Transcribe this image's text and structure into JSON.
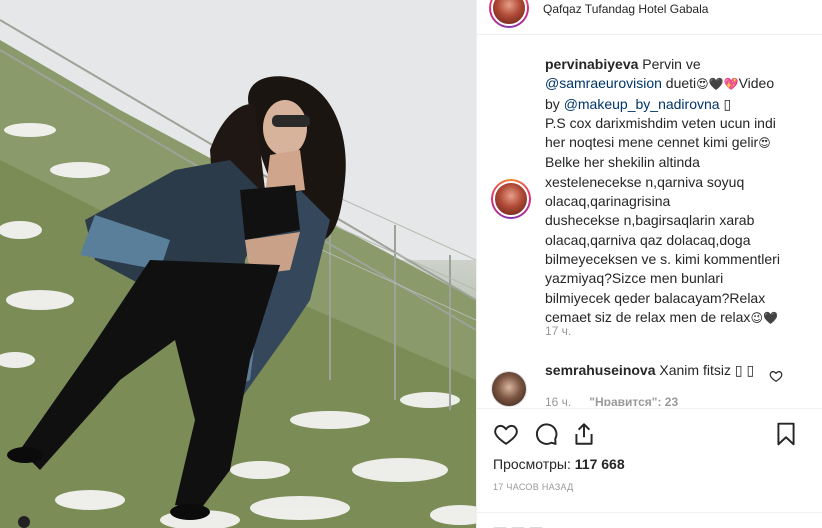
{
  "post": {
    "location": "Qafqaz Tufandag Hotel Gabala",
    "author": "pervinabiyeva",
    "caption_lines": [
      [
        {
          "t": "Pervin ve",
          "c": ""
        }
      ],
      [
        {
          "t": "@samraeurovision",
          "c": "mention"
        },
        {
          "t": " dueti",
          "c": ""
        },
        {
          "t": "😍🖤💖",
          "c": "emoji"
        },
        {
          "t": "Video",
          "c": ""
        }
      ],
      [
        {
          "t": "by ",
          "c": ""
        },
        {
          "t": "@makeup_by_nadirovna",
          "c": "mention"
        },
        {
          "t": " ▯",
          "c": ""
        }
      ],
      [
        {
          "t": "P.S cox darixmishdim veten ucun indi",
          "c": ""
        }
      ],
      [
        {
          "t": "her noqtesi mene cennet kimi gelir",
          "c": ""
        },
        {
          "t": "😍",
          "c": "emoji"
        }
      ],
      [
        {
          "t": "Belke her shekilin altinda",
          "c": ""
        }
      ],
      [
        {
          "t": "xestelenecekse n,qarniva soyuq",
          "c": ""
        }
      ],
      [
        {
          "t": "olacaq,qarinagrisina",
          "c": ""
        }
      ],
      [
        {
          "t": "dushecekse n,bagirsaqlarin xarab",
          "c": ""
        }
      ],
      [
        {
          "t": "olacaq,qarniva qaz dolacaq,doga",
          "c": ""
        }
      ],
      [
        {
          "t": "bilmeyeceksen ve s. kimi kommentleri",
          "c": ""
        }
      ],
      [
        {
          "t": "yazmiyaq?Sizce men bunlari",
          "c": ""
        }
      ],
      [
        {
          "t": "bilmiyecek qeder balacayam?Relax",
          "c": ""
        }
      ],
      [
        {
          "t": "cemaet siz de relax men de relax",
          "c": ""
        },
        {
          "t": "😉🖤",
          "c": "emoji"
        }
      ]
    ],
    "caption_time": "17 ч.",
    "comment": {
      "username": "semrahuseinova",
      "text": "Xanim fitsiz ▯ ▯",
      "time": "16 ч.",
      "likes": "\"Нравится\": 23"
    },
    "views_label": "Просмотры:",
    "views_count": "117 668",
    "timestamp": "17 часов назад"
  },
  "icons": [
    "heart-icon",
    "comment-icon",
    "share-icon",
    "bookmark-icon",
    "small-heart-icon"
  ],
  "colors": {
    "mention": "#003569",
    "muted": "#999999",
    "text": "#262626"
  }
}
